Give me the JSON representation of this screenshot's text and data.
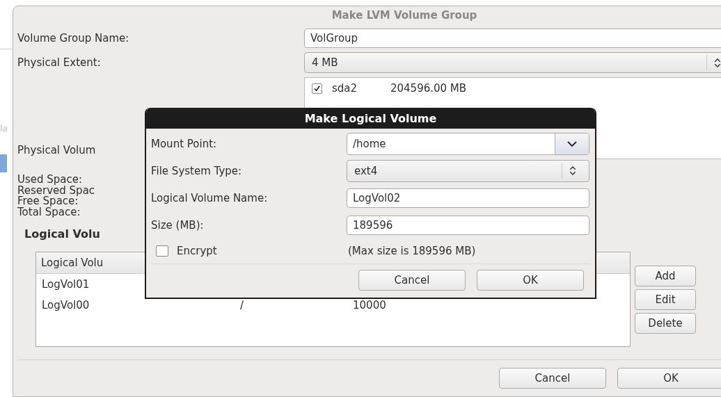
{
  "behind_window": {
    "fragment": "la"
  },
  "dialog": {
    "title": "Make LVM Volume Group",
    "volume_group_name": {
      "label": "Volume Group Name:",
      "value": "VolGroup"
    },
    "physical_extent": {
      "label": "Physical Extent:",
      "value": "4 MB"
    },
    "physical_volumes": {
      "label": "Physical Volum",
      "items": [
        {
          "name": "sda2",
          "size": "204596.00 MB",
          "checked": true
        }
      ]
    },
    "space_labels": [
      "Used Space:",
      "Reserved Spac",
      "Free Space:",
      "Total Space:"
    ],
    "logical_volumes": {
      "heading": "Logical Volu",
      "columns": [
        "Logical Volu"
      ],
      "rows": [
        {
          "name": "LogVol01"
        },
        {
          "name": "LogVol00",
          "mount_point": "/",
          "size": "10000"
        }
      ],
      "buttons": [
        "Add",
        "Edit",
        "Delete"
      ]
    },
    "buttons": [
      "Cancel",
      "OK"
    ]
  },
  "modal": {
    "title": "Make Logical Volume",
    "fields": [
      {
        "kind": "combo-entry",
        "label": "Mount Point:",
        "value": "/home"
      },
      {
        "kind": "combo",
        "label": "File System Type:",
        "value": "ext4"
      },
      {
        "kind": "entry",
        "label": "Logical Volume Name:",
        "value": "LogVol02"
      },
      {
        "kind": "entry",
        "label": "Size (MB):",
        "value": "189596"
      }
    ],
    "encrypt": {
      "label": "Encrypt",
      "checked": false
    },
    "max_size_note": "(Max size is 189596 MB)",
    "buttons": [
      "Cancel",
      "OK"
    ]
  }
}
